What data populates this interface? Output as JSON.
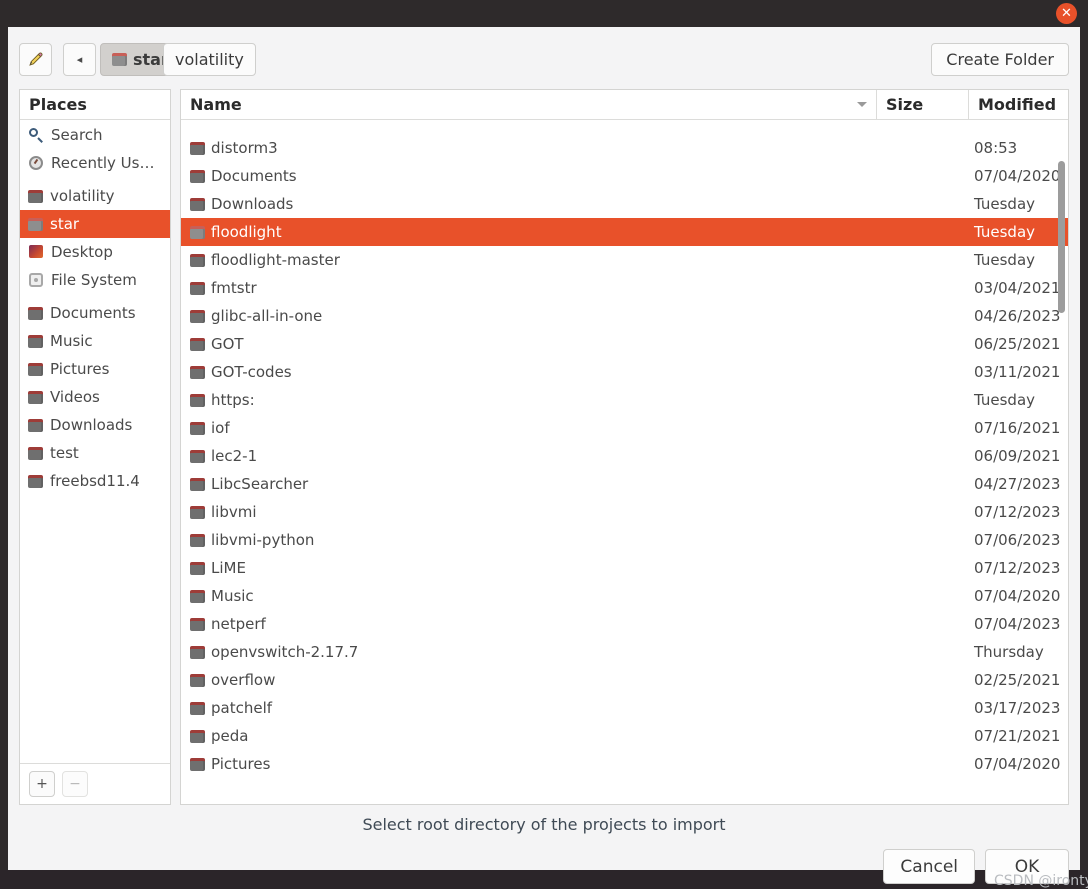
{
  "titlebar": {
    "close_label": "✕"
  },
  "toolbar": {
    "pencil_icon": "pencil-icon",
    "pencil_label": "✎",
    "back_label": "◂",
    "breadcrumbs": [
      {
        "label": "star",
        "active": true
      },
      {
        "label": "volatility",
        "active": false
      }
    ],
    "create_folder_label": "Create Folder"
  },
  "places": {
    "header": "Places",
    "items": [
      {
        "label": "Search",
        "icon": "search-icon"
      },
      {
        "label": "Recently Us…",
        "icon": "recent-icon"
      },
      {
        "label": "volatility",
        "icon": "folder-icon"
      },
      {
        "label": "star",
        "icon": "folder-icon",
        "selected": true
      },
      {
        "label": "Desktop",
        "icon": "desktop-icon"
      },
      {
        "label": "File System",
        "icon": "filesystem-icon"
      },
      {
        "label": "Documents",
        "icon": "folder-icon"
      },
      {
        "label": "Music",
        "icon": "folder-icon"
      },
      {
        "label": "Pictures",
        "icon": "folder-icon"
      },
      {
        "label": "Videos",
        "icon": "folder-icon"
      },
      {
        "label": "Downloads",
        "icon": "folder-icon"
      },
      {
        "label": "test",
        "icon": "folder-icon"
      },
      {
        "label": "freebsd11.4",
        "icon": "folder-icon"
      }
    ],
    "add_label": "+",
    "remove_label": "−"
  },
  "files": {
    "columns": [
      "Name",
      "Size",
      "Modified"
    ],
    "sort_column": "Name",
    "sort_indicator": "chevron-down-icon",
    "rows": [
      {
        "name": "",
        "size": "",
        "modified": ""
      },
      {
        "name": "distorm3",
        "size": "",
        "modified": "08:53"
      },
      {
        "name": "Documents",
        "size": "",
        "modified": "07/04/2020"
      },
      {
        "name": "Downloads",
        "size": "",
        "modified": "Tuesday"
      },
      {
        "name": "floodlight",
        "size": "",
        "modified": "Tuesday",
        "selected": true
      },
      {
        "name": "floodlight-master",
        "size": "",
        "modified": "Tuesday"
      },
      {
        "name": "fmtstr",
        "size": "",
        "modified": "03/04/2021"
      },
      {
        "name": "glibc-all-in-one",
        "size": "",
        "modified": "04/26/2023"
      },
      {
        "name": "GOT",
        "size": "",
        "modified": "06/25/2021"
      },
      {
        "name": "GOT-codes",
        "size": "",
        "modified": "03/11/2021"
      },
      {
        "name": "https:",
        "size": "",
        "modified": "Tuesday"
      },
      {
        "name": "iof",
        "size": "",
        "modified": "07/16/2021"
      },
      {
        "name": "lec2-1",
        "size": "",
        "modified": "06/09/2021"
      },
      {
        "name": "LibcSearcher",
        "size": "",
        "modified": "04/27/2023"
      },
      {
        "name": "libvmi",
        "size": "",
        "modified": "07/12/2023"
      },
      {
        "name": "libvmi-python",
        "size": "",
        "modified": "07/06/2023"
      },
      {
        "name": "LiME",
        "size": "",
        "modified": "07/12/2023"
      },
      {
        "name": "Music",
        "size": "",
        "modified": "07/04/2020"
      },
      {
        "name": "netperf",
        "size": "",
        "modified": "07/04/2023"
      },
      {
        "name": "openvswitch-2.17.7",
        "size": "",
        "modified": "Thursday"
      },
      {
        "name": "overflow",
        "size": "",
        "modified": "02/25/2021"
      },
      {
        "name": "patchelf",
        "size": "",
        "modified": "03/17/2023"
      },
      {
        "name": "peda",
        "size": "",
        "modified": "07/21/2021"
      },
      {
        "name": "Pictures",
        "size": "",
        "modified": "07/04/2020"
      }
    ]
  },
  "footer": {
    "status": "Select root directory of the projects to import",
    "cancel_label": "Cancel",
    "ok_label": "OK"
  },
  "watermark": "CSDN @irontys",
  "colors": {
    "accent": "#e8512a",
    "titlebar": "#2e2a2b",
    "dialog_bg": "#f4f4f5",
    "pane_bg": "#ffffff",
    "text": "#4a4a4a"
  }
}
